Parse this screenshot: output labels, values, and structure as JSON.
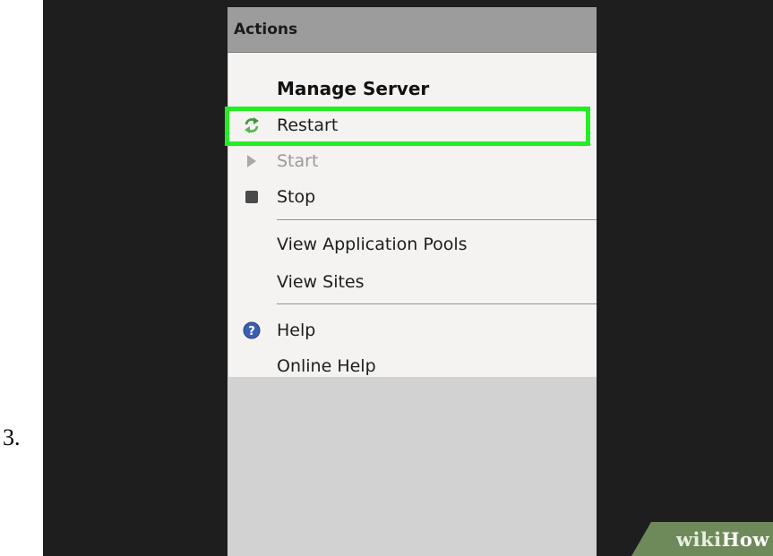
{
  "step": {
    "number": "3."
  },
  "panel": {
    "header": "Actions",
    "items": [
      {
        "label": "Manage Server",
        "icon": "none",
        "state": "heading"
      },
      {
        "label": "Restart",
        "icon": "restart-icon",
        "state": "highlighted"
      },
      {
        "label": "Start",
        "icon": "play-icon",
        "state": "disabled"
      },
      {
        "label": "Stop",
        "icon": "stop-icon",
        "state": "enabled"
      },
      {
        "label": "View Application Pools",
        "icon": "none",
        "state": "enabled"
      },
      {
        "label": "View Sites",
        "icon": "none",
        "state": "enabled"
      },
      {
        "label": "Help",
        "icon": "help-icon",
        "state": "enabled"
      },
      {
        "label": "Online Help",
        "icon": "none",
        "state": "enabled"
      }
    ]
  },
  "watermark": {
    "wiki": "wiki",
    "how": "How"
  },
  "colors": {
    "highlight": "#22ee22",
    "background": "#1e1e1e",
    "panel": "#f4f3f1",
    "header": "#9c9c9c"
  }
}
